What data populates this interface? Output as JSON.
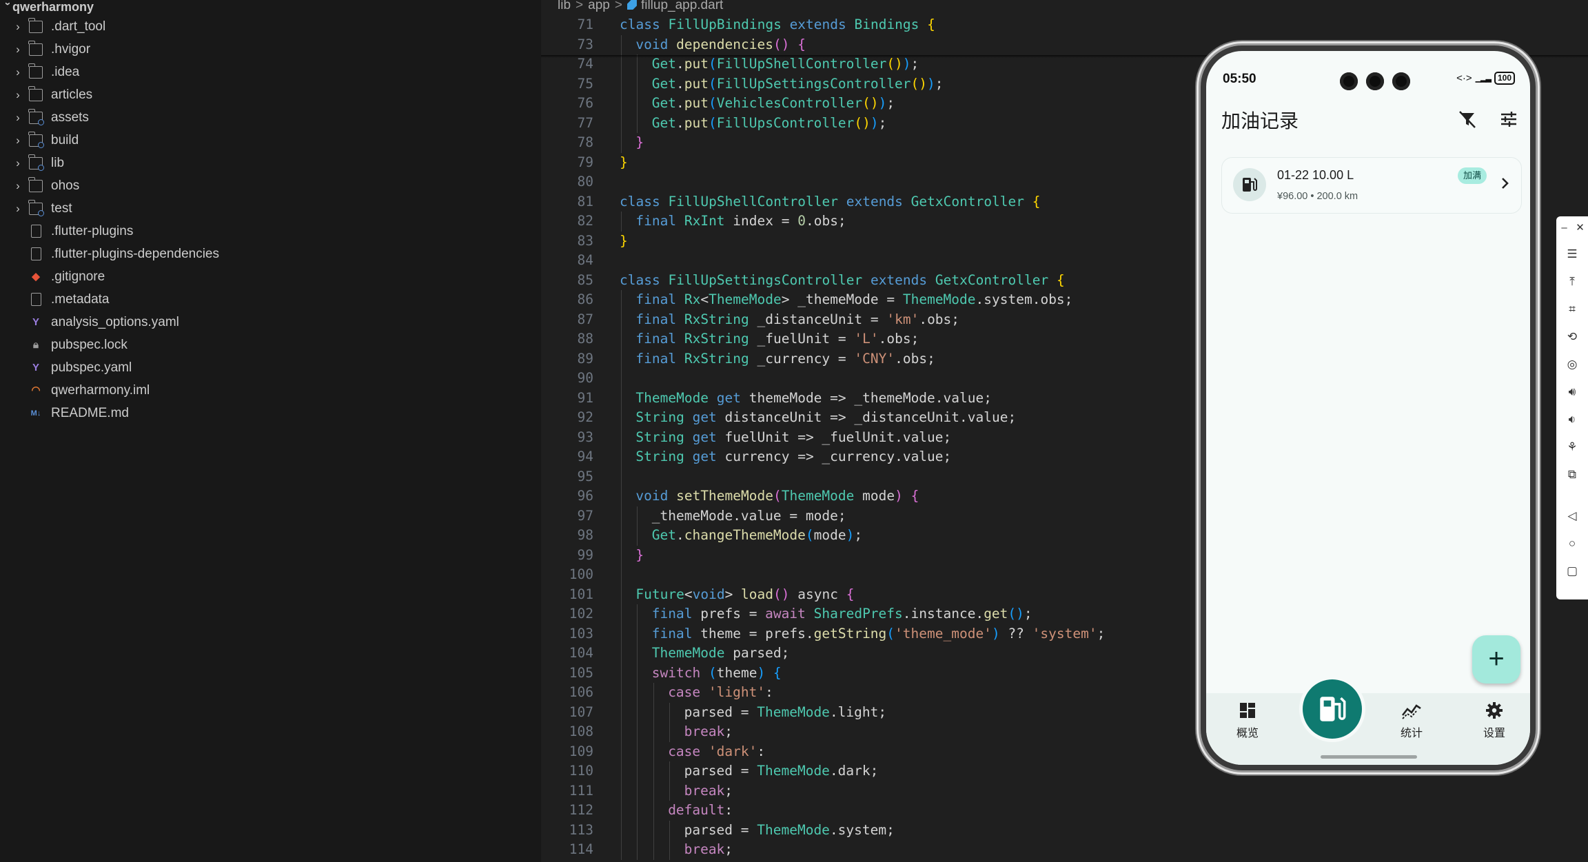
{
  "explorer": {
    "root": "qwerharmony",
    "items": [
      {
        "label": ".dart_tool",
        "kind": "folder"
      },
      {
        "label": ".hvigor",
        "kind": "folder"
      },
      {
        "label": ".idea",
        "kind": "folder"
      },
      {
        "label": "articles",
        "kind": "folder"
      },
      {
        "label": "assets",
        "kind": "folder-assets"
      },
      {
        "label": "build",
        "kind": "folder-build"
      },
      {
        "label": "lib",
        "kind": "folder-lib"
      },
      {
        "label": "ohos",
        "kind": "folder"
      },
      {
        "label": "test",
        "kind": "folder-test"
      },
      {
        "label": ".flutter-plugins",
        "kind": "file"
      },
      {
        "label": ".flutter-plugins-dependencies",
        "kind": "file"
      },
      {
        "label": ".gitignore",
        "kind": "git"
      },
      {
        "label": ".metadata",
        "kind": "file"
      },
      {
        "label": "analysis_options.yaml",
        "kind": "yaml"
      },
      {
        "label": "pubspec.lock",
        "kind": "lock"
      },
      {
        "label": "pubspec.yaml",
        "kind": "yaml"
      },
      {
        "label": "qwerharmony.iml",
        "kind": "rss"
      },
      {
        "label": "README.md",
        "kind": "md"
      }
    ]
  },
  "editor": {
    "breadcrumb": [
      "lib",
      "app",
      "fillup_app.dart"
    ],
    "lines": [
      {
        "n": "71",
        "i": 0,
        "code": [
          [
            "kw",
            "class "
          ],
          [
            "ty",
            "FillUpBindings "
          ],
          [
            "kw",
            "extends "
          ],
          [
            "ty",
            "Bindings "
          ],
          [
            "br1",
            "{"
          ]
        ]
      },
      {
        "n": "73",
        "i": 1,
        "code": [
          [
            "kw",
            "void "
          ],
          [
            "fn",
            "dependencies"
          ],
          [
            "br2",
            "() "
          ],
          [
            "br2",
            "{"
          ]
        ]
      },
      {
        "n": "74",
        "i": 2,
        "code": [
          [
            "ty",
            "Get"
          ],
          [
            "var",
            "."
          ],
          [
            "fn",
            "put"
          ],
          [
            "br3",
            "("
          ],
          [
            "ty",
            "FillUpShellController"
          ],
          [
            "br1",
            "()"
          ],
          [
            "br3",
            ")"
          ],
          [
            "var",
            ";"
          ]
        ]
      },
      {
        "n": "75",
        "i": 2,
        "code": [
          [
            "ty",
            "Get"
          ],
          [
            "var",
            "."
          ],
          [
            "fn",
            "put"
          ],
          [
            "br3",
            "("
          ],
          [
            "ty",
            "FillUpSettingsController"
          ],
          [
            "br1",
            "()"
          ],
          [
            "br3",
            ")"
          ],
          [
            "var",
            ";"
          ]
        ]
      },
      {
        "n": "76",
        "i": 2,
        "code": [
          [
            "ty",
            "Get"
          ],
          [
            "var",
            "."
          ],
          [
            "fn",
            "put"
          ],
          [
            "br3",
            "("
          ],
          [
            "ty",
            "VehiclesController"
          ],
          [
            "br1",
            "()"
          ],
          [
            "br3",
            ")"
          ],
          [
            "var",
            ";"
          ]
        ]
      },
      {
        "n": "77",
        "i": 2,
        "code": [
          [
            "ty",
            "Get"
          ],
          [
            "var",
            "."
          ],
          [
            "fn",
            "put"
          ],
          [
            "br3",
            "("
          ],
          [
            "ty",
            "FillUpsController"
          ],
          [
            "br1",
            "()"
          ],
          [
            "br3",
            ")"
          ],
          [
            "var",
            ";"
          ]
        ]
      },
      {
        "n": "78",
        "i": 1,
        "code": [
          [
            "br2",
            "}"
          ]
        ]
      },
      {
        "n": "79",
        "i": 0,
        "code": [
          [
            "br1",
            "}"
          ]
        ]
      },
      {
        "n": "80",
        "i": 0,
        "code": []
      },
      {
        "n": "81",
        "i": 0,
        "code": [
          [
            "kw",
            "class "
          ],
          [
            "ty",
            "FillUpShellController "
          ],
          [
            "kw",
            "extends "
          ],
          [
            "ty",
            "GetxController "
          ],
          [
            "br1",
            "{"
          ]
        ]
      },
      {
        "n": "82",
        "i": 1,
        "code": [
          [
            "kw",
            "final "
          ],
          [
            "ty",
            "RxInt "
          ],
          [
            "var",
            "index = "
          ],
          [
            "num",
            "0"
          ],
          [
            "var",
            ".obs;"
          ]
        ]
      },
      {
        "n": "83",
        "i": 0,
        "code": [
          [
            "br1",
            "}"
          ]
        ]
      },
      {
        "n": "84",
        "i": 0,
        "code": []
      },
      {
        "n": "85",
        "i": 0,
        "code": [
          [
            "kw",
            "class "
          ],
          [
            "ty",
            "FillUpSettingsController "
          ],
          [
            "kw",
            "extends "
          ],
          [
            "ty",
            "GetxController "
          ],
          [
            "br1",
            "{"
          ]
        ]
      },
      {
        "n": "86",
        "i": 1,
        "code": [
          [
            "kw",
            "final "
          ],
          [
            "ty",
            "Rx"
          ],
          [
            "var",
            "<"
          ],
          [
            "ty",
            "ThemeMode"
          ],
          [
            "var",
            "> _themeMode = "
          ],
          [
            "ty",
            "ThemeMode"
          ],
          [
            "var",
            ".system.obs;"
          ]
        ]
      },
      {
        "n": "87",
        "i": 1,
        "code": [
          [
            "kw",
            "final "
          ],
          [
            "ty",
            "RxString "
          ],
          [
            "var",
            "_distanceUnit = "
          ],
          [
            "str",
            "'km'"
          ],
          [
            "var",
            ".obs;"
          ]
        ]
      },
      {
        "n": "88",
        "i": 1,
        "code": [
          [
            "kw",
            "final "
          ],
          [
            "ty",
            "RxString "
          ],
          [
            "var",
            "_fuelUnit = "
          ],
          [
            "str",
            "'L'"
          ],
          [
            "var",
            ".obs;"
          ]
        ]
      },
      {
        "n": "89",
        "i": 1,
        "code": [
          [
            "kw",
            "final "
          ],
          [
            "ty",
            "RxString "
          ],
          [
            "var",
            "_currency = "
          ],
          [
            "str",
            "'CNY'"
          ],
          [
            "var",
            ".obs;"
          ]
        ]
      },
      {
        "n": "90",
        "i": 1,
        "code": []
      },
      {
        "n": "91",
        "i": 1,
        "code": [
          [
            "ty",
            "ThemeMode "
          ],
          [
            "kw",
            "get "
          ],
          [
            "var",
            "themeMode => _themeMode.value;"
          ]
        ]
      },
      {
        "n": "92",
        "i": 1,
        "code": [
          [
            "ty",
            "String "
          ],
          [
            "kw",
            "get "
          ],
          [
            "var",
            "distanceUnit => _distanceUnit.value;"
          ]
        ]
      },
      {
        "n": "93",
        "i": 1,
        "code": [
          [
            "ty",
            "String "
          ],
          [
            "kw",
            "get "
          ],
          [
            "var",
            "fuelUnit => _fuelUnit.value;"
          ]
        ]
      },
      {
        "n": "94",
        "i": 1,
        "code": [
          [
            "ty",
            "String "
          ],
          [
            "kw",
            "get "
          ],
          [
            "var",
            "currency => _currency.value;"
          ]
        ]
      },
      {
        "n": "95",
        "i": 1,
        "code": []
      },
      {
        "n": "96",
        "i": 1,
        "code": [
          [
            "kw",
            "void "
          ],
          [
            "fn",
            "setThemeMode"
          ],
          [
            "br2",
            "("
          ],
          [
            "ty",
            "ThemeMode "
          ],
          [
            "var",
            "mode"
          ],
          [
            "br2",
            ") "
          ],
          [
            "br2",
            "{"
          ]
        ]
      },
      {
        "n": "97",
        "i": 2,
        "code": [
          [
            "var",
            "_themeMode.value = mode;"
          ]
        ]
      },
      {
        "n": "98",
        "i": 2,
        "code": [
          [
            "ty",
            "Get"
          ],
          [
            "var",
            "."
          ],
          [
            "fn",
            "changeThemeMode"
          ],
          [
            "br3",
            "("
          ],
          [
            "var",
            "mode"
          ],
          [
            "br3",
            ")"
          ],
          [
            "var",
            ";"
          ]
        ]
      },
      {
        "n": "99",
        "i": 1,
        "code": [
          [
            "br2",
            "}"
          ]
        ]
      },
      {
        "n": "100",
        "i": 1,
        "code": []
      },
      {
        "n": "101",
        "i": 1,
        "code": [
          [
            "ty",
            "Future"
          ],
          [
            "var",
            "<"
          ],
          [
            "kw",
            "void"
          ],
          [
            "var",
            "> "
          ],
          [
            "fn",
            "load"
          ],
          [
            "br2",
            "() "
          ],
          [
            "var",
            "async "
          ],
          [
            "br2",
            "{"
          ]
        ]
      },
      {
        "n": "102",
        "i": 2,
        "code": [
          [
            "kw",
            "final "
          ],
          [
            "var",
            "prefs = "
          ],
          [
            "ctl",
            "await "
          ],
          [
            "ty",
            "SharedPrefs"
          ],
          [
            "var",
            "."
          ],
          [
            "var",
            "instance."
          ],
          [
            "fn",
            "get"
          ],
          [
            "br3",
            "()"
          ],
          [
            "var",
            ";"
          ]
        ]
      },
      {
        "n": "103",
        "i": 2,
        "code": [
          [
            "kw",
            "final "
          ],
          [
            "var",
            "theme = prefs."
          ],
          [
            "fn",
            "getString"
          ],
          [
            "br3",
            "("
          ],
          [
            "str",
            "'theme_mode'"
          ],
          [
            "br3",
            ") "
          ],
          [
            "var",
            "?? "
          ],
          [
            "str",
            "'system'"
          ],
          [
            "var",
            ";"
          ]
        ]
      },
      {
        "n": "104",
        "i": 2,
        "code": [
          [
            "ty",
            "ThemeMode "
          ],
          [
            "var",
            "parsed;"
          ]
        ]
      },
      {
        "n": "105",
        "i": 2,
        "code": [
          [
            "ctl",
            "switch "
          ],
          [
            "br3",
            "("
          ],
          [
            "var",
            "theme"
          ],
          [
            "br3",
            ") "
          ],
          [
            "br3",
            "{"
          ]
        ]
      },
      {
        "n": "106",
        "i": 3,
        "code": [
          [
            "ctl",
            "case "
          ],
          [
            "str",
            "'light'"
          ],
          [
            "var",
            ":"
          ]
        ]
      },
      {
        "n": "107",
        "i": 4,
        "code": [
          [
            "var",
            "parsed = "
          ],
          [
            "ty",
            "ThemeMode"
          ],
          [
            "var",
            ".light;"
          ]
        ]
      },
      {
        "n": "108",
        "i": 4,
        "code": [
          [
            "ctl",
            "break"
          ],
          [
            "var",
            ";"
          ]
        ]
      },
      {
        "n": "109",
        "i": 3,
        "code": [
          [
            "ctl",
            "case "
          ],
          [
            "str",
            "'dark'"
          ],
          [
            "var",
            ":"
          ]
        ]
      },
      {
        "n": "110",
        "i": 4,
        "code": [
          [
            "var",
            "parsed = "
          ],
          [
            "ty",
            "ThemeMode"
          ],
          [
            "var",
            ".dark;"
          ]
        ]
      },
      {
        "n": "111",
        "i": 4,
        "code": [
          [
            "ctl",
            "break"
          ],
          [
            "var",
            ";"
          ]
        ]
      },
      {
        "n": "112",
        "i": 3,
        "code": [
          [
            "ctl",
            "default"
          ],
          [
            "var",
            ":"
          ]
        ]
      },
      {
        "n": "113",
        "i": 4,
        "code": [
          [
            "var",
            "parsed = "
          ],
          [
            "ty",
            "ThemeMode"
          ],
          [
            "var",
            ".system;"
          ]
        ]
      },
      {
        "n": "114",
        "i": 4,
        "code": [
          [
            "ctl",
            "break"
          ],
          [
            "var",
            ";"
          ]
        ]
      }
    ]
  },
  "phone": {
    "time": "05:50",
    "battery": "100",
    "network": "<·>",
    "title": "加油记录",
    "record": {
      "title": "01-22  10.00 L",
      "subtitle": "¥96.00  •  200.0 km",
      "badge": "加满"
    },
    "fab": "+",
    "nav": {
      "overview": "概览",
      "stats": "统计",
      "settings": "设置"
    },
    "colors": {
      "accent": "#0f7a70",
      "fab": "#a3e9dc",
      "badge": "#a8ece0"
    }
  },
  "emulator_tools": [
    "minimize-icon",
    "close-icon",
    "menu-icon",
    "pin-top-icon",
    "crop-icon",
    "rotate-icon",
    "screenshot-icon",
    "volume-up-icon",
    "volume-down-icon",
    "shake-icon",
    "copy-icon",
    "back-icon",
    "home-icon",
    "recents-icon"
  ]
}
